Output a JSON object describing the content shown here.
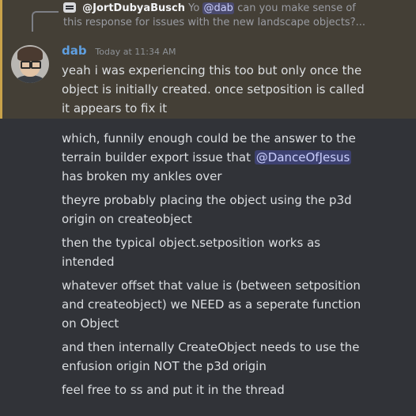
{
  "reply": {
    "icon": "reply-thread-icon",
    "username": "@JortDubyaBusch",
    "preview_prefix": "Yo",
    "mention": "@dab",
    "preview_line1": "can you make sense of",
    "preview_line2": "this response for issues with the new landscape objects?..."
  },
  "author": {
    "name": "dab",
    "timestamp": "Today at 11:34 AM"
  },
  "messages": [
    {
      "lines": [
        "yeah i was experiencing this too but only once the",
        "object is initially created. once setposition is called",
        "it appears to fix it"
      ]
    },
    {
      "line1": "which, funnily enough could be the answer to the",
      "line2_before": "terrain builder export issue that",
      "mention": "@DanceOfJesus",
      "line3": "has broken my ankles over"
    },
    {
      "lines": [
        "theyre probably placing the object using the p3d",
        "origin on createobject"
      ]
    },
    {
      "lines": [
        "then the typical object.setposition works as",
        "intended"
      ]
    },
    {
      "lines": [
        "whatever offset that value is (between setposition",
        "and createobject) we NEED as a seperate function",
        "on Object"
      ]
    },
    {
      "lines": [
        "and then internally CreateObject needs to use the",
        "enfusion origin NOT the p3d origin"
      ]
    },
    {
      "lines": [
        "feel free to ss and put it in the thread"
      ]
    }
  ],
  "colors": {
    "background": "#313338",
    "highlight": "#443f36",
    "highlight_bar": "#c9a24a",
    "author": "#5f9fe0",
    "mention_text": "#c9cdfb"
  }
}
